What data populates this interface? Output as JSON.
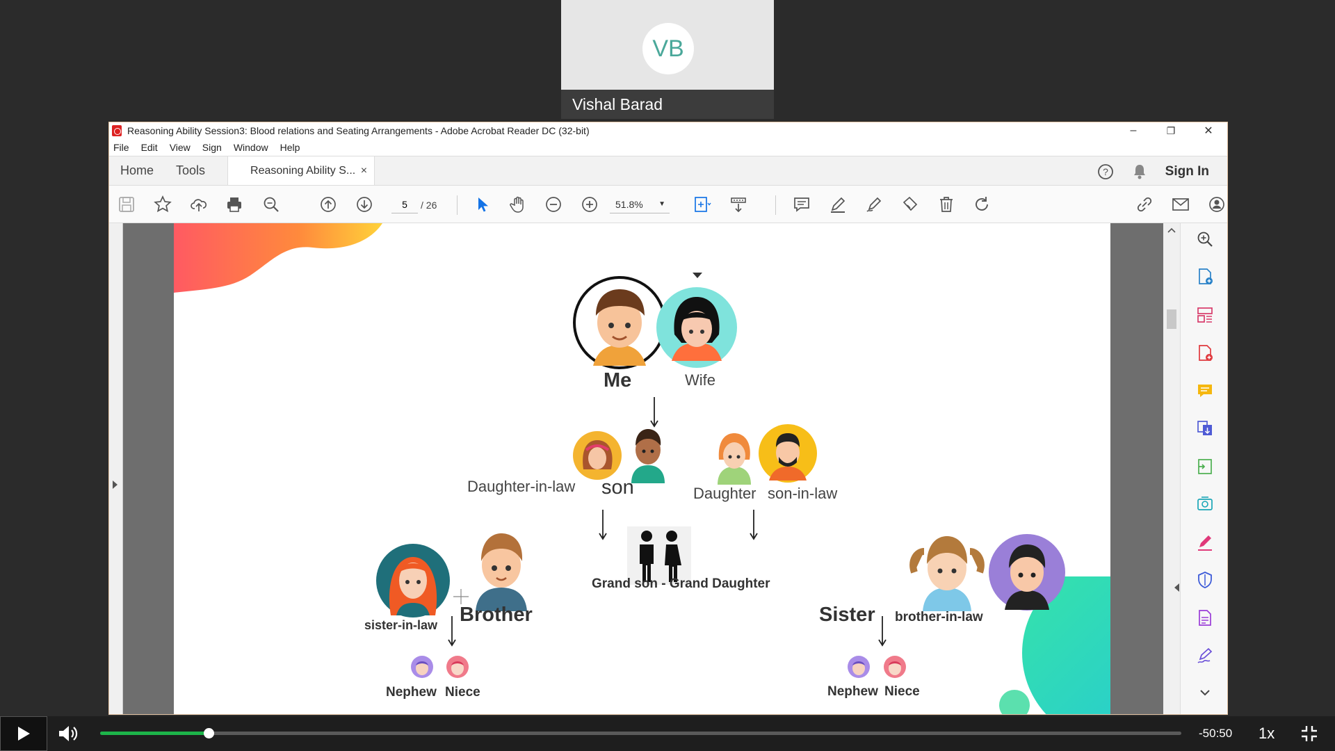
{
  "webcam": {
    "initials": "VB",
    "name": "Vishal Barad"
  },
  "window": {
    "title": "Reasoning Ability Session3: Blood relations and Seating Arrangements - Adobe Acrobat Reader DC (32-bit)",
    "minimize": "–",
    "restore": "❐",
    "close": "✕"
  },
  "menu": [
    "File",
    "Edit",
    "View",
    "Sign",
    "Window",
    "Help"
  ],
  "tabs": {
    "home": "Home",
    "tools": "Tools",
    "doc": "Reasoning Ability S...",
    "doc_close": "×",
    "sign_in": "Sign In"
  },
  "toolbar": {
    "page_current": "5",
    "page_sep_total": "/  26",
    "zoom": "51.8%"
  },
  "family": {
    "me": "Me",
    "wife": "Wife",
    "daughter_in_law": "Daughter-in-law",
    "son": "son",
    "daughter": "Daughter",
    "son_in_law": "son-in-law",
    "grandkids": "Grand son - Grand Daughter",
    "sister_in_law": "sister-in-law",
    "brother": "Brother",
    "sister": "Sister",
    "brother_in_law": "brother-in-law",
    "nephew_left": "Nephew",
    "niece_left": "Niece",
    "nephew_right": "Nephew",
    "niece_right": "Niece"
  },
  "player": {
    "time_remaining": "-50:50",
    "speed": "1x",
    "progress": 0.1
  },
  "colors": {
    "accent_green": "#1db44a",
    "teal": "#2ad6b4",
    "acrobat_blue": "#1473e6"
  }
}
